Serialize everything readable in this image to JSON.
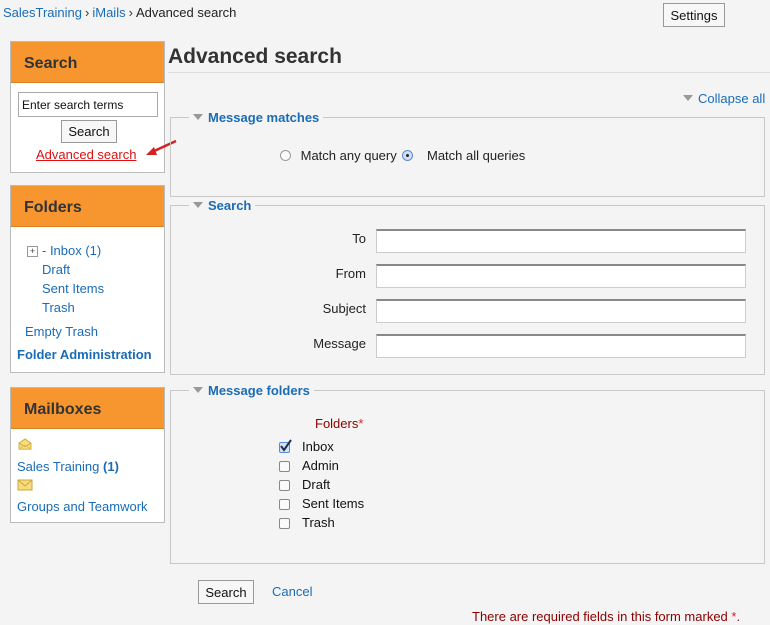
{
  "breadcrumb": {
    "items": [
      {
        "label": "SalesTraining",
        "link": true
      },
      {
        "label": "iMails",
        "link": true
      },
      {
        "label": "Advanced search",
        "link": false
      }
    ],
    "separator": "›"
  },
  "header": {
    "settings_label": "Settings"
  },
  "sidebar": {
    "search_block": {
      "title": "Search",
      "input_value": "Enter search terms",
      "button_label": "Search",
      "advanced_link": "Advanced search"
    },
    "folders_block": {
      "title": "Folders",
      "expand_glyph": "+",
      "items": [
        {
          "label": "- Inbox (1)"
        },
        {
          "label": "Draft"
        },
        {
          "label": "Sent Items"
        },
        {
          "label": "Trash"
        }
      ],
      "empty_trash": "Empty Trash",
      "folder_admin": "Folder Administration"
    },
    "mailboxes_block": {
      "title": "Mailboxes",
      "items": [
        {
          "name": "Sales Training",
          "count": "(1)",
          "icon": "open-envelope-icon"
        },
        {
          "name": "Groups and Teamwork",
          "count": "",
          "icon": "closed-envelope-icon"
        }
      ]
    }
  },
  "main": {
    "title": "Advanced search",
    "collapse_all": "Collapse all",
    "message_matches": {
      "legend": "Message matches",
      "options": [
        {
          "label": "Match any query",
          "selected": false
        },
        {
          "label": "Match all queries",
          "selected": true
        }
      ]
    },
    "search": {
      "legend": "Search",
      "fields": [
        {
          "label": "To",
          "value": ""
        },
        {
          "label": "From",
          "value": ""
        },
        {
          "label": "Subject",
          "value": ""
        },
        {
          "label": "Message",
          "value": ""
        }
      ]
    },
    "message_folders": {
      "legend": "Message folders",
      "folders_label": "Folders",
      "required_marker": "*",
      "options": [
        {
          "label": "Inbox",
          "checked": true
        },
        {
          "label": "Admin",
          "checked": false
        },
        {
          "label": "Draft",
          "checked": false
        },
        {
          "label": "Sent Items",
          "checked": false
        },
        {
          "label": "Trash",
          "checked": false
        }
      ]
    },
    "submit_label": "Search",
    "cancel_label": "Cancel",
    "required_note": "There are required fields in this form marked",
    "required_marker": "*",
    "required_note_end": "."
  },
  "colors": {
    "accent_orange": "#f7952e",
    "link_blue": "#1a6cb5",
    "required_red": "#8b0000",
    "annotation_arrow": "#d11"
  }
}
